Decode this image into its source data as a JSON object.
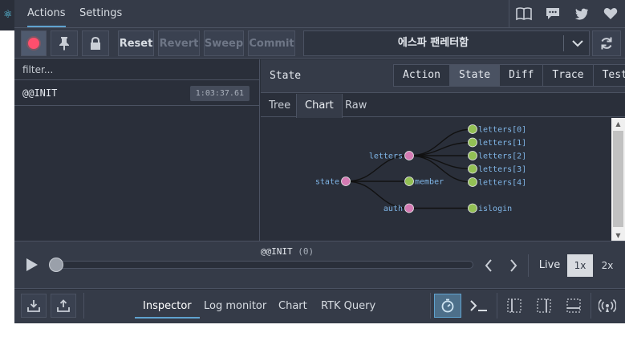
{
  "top_tabs": {
    "actions": "Actions",
    "settings": "Settings"
  },
  "top_icons": [
    "book-icon",
    "chat-icon",
    "twitter-icon",
    "heart-icon"
  ],
  "toolbar": {
    "reset": "Reset",
    "revert": "Revert",
    "sweep": "Sweep",
    "commit": "Commit",
    "instance": "에스파 팬레터함"
  },
  "filter": {
    "placeholder": "filter..."
  },
  "actions_list": [
    {
      "name": "@@INIT",
      "time": "1:03:37.61"
    }
  ],
  "inspector": {
    "title": "State",
    "modes": [
      "Action",
      "State",
      "Diff",
      "Trace",
      "Test"
    ],
    "active_mode": "State",
    "sub_tabs": [
      "Tree",
      "Chart",
      "Raw"
    ],
    "active_sub_tab": "Chart"
  },
  "tree_chart": {
    "root": "state",
    "children": [
      {
        "name": "letters",
        "children": [
          "letters[0]",
          "letters[1]",
          "letters[2]",
          "letters[3]",
          "letters[4]"
        ]
      },
      {
        "name": "member",
        "children": []
      },
      {
        "name": "auth",
        "children": [
          "islogin"
        ]
      }
    ],
    "colors": {
      "internal": "#d47ab3",
      "leaf": "#93c054",
      "link": "#111111",
      "label": "#7fb5e6"
    }
  },
  "slider": {
    "action": "@@INIT",
    "index": "(0)",
    "live": "Live",
    "speed_1x": "1x",
    "speed_2x": "2x"
  },
  "bottom": {
    "tabs": [
      "Inspector",
      "Log monitor",
      "Chart",
      "RTK Query"
    ],
    "active_tab": "Inspector"
  }
}
